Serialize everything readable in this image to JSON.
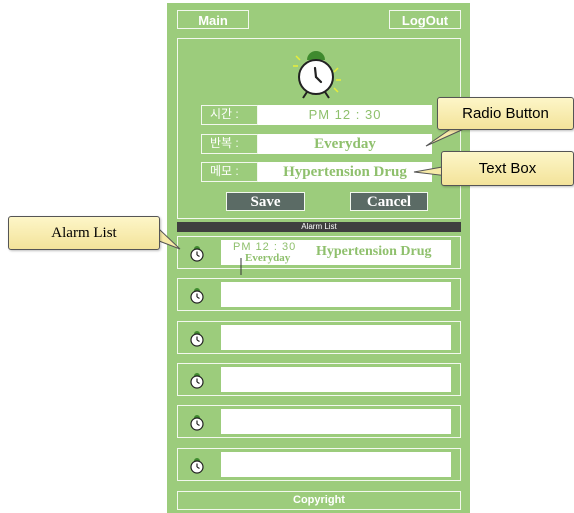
{
  "header": {
    "main_label": "Main",
    "logout_label": "LogOut"
  },
  "form": {
    "time_label": "시간 :",
    "time_value": "PM  12 : 30",
    "repeat_label": "반복 :",
    "repeat_value": "Everyday",
    "memo_label": "메모 :",
    "memo_value": "Hypertension Drug"
  },
  "actions": {
    "save_label": "Save",
    "cancel_label": "Cancel"
  },
  "alarm_list": {
    "title": "Alarm List",
    "items": [
      {
        "time": "PM  12 : 30",
        "repeat": "Everyday",
        "memo": "Hypertension Drug"
      },
      {
        "time": "",
        "repeat": "",
        "memo": ""
      },
      {
        "time": "",
        "repeat": "",
        "memo": ""
      },
      {
        "time": "",
        "repeat": "",
        "memo": ""
      },
      {
        "time": "",
        "repeat": "",
        "memo": ""
      },
      {
        "time": "",
        "repeat": "",
        "memo": ""
      }
    ]
  },
  "footer": {
    "copyright": "Copyright"
  },
  "annotations": {
    "radio_button": "Radio Button",
    "text_box": "Text Box",
    "alarm_list": "Alarm List"
  },
  "colors": {
    "background": "#9ccc7c",
    "text_green": "#8fc06d",
    "button": "#5b6b65",
    "callout": "#f7eaa8"
  },
  "icons": {
    "alarm_clock": "alarm-clock-icon"
  }
}
